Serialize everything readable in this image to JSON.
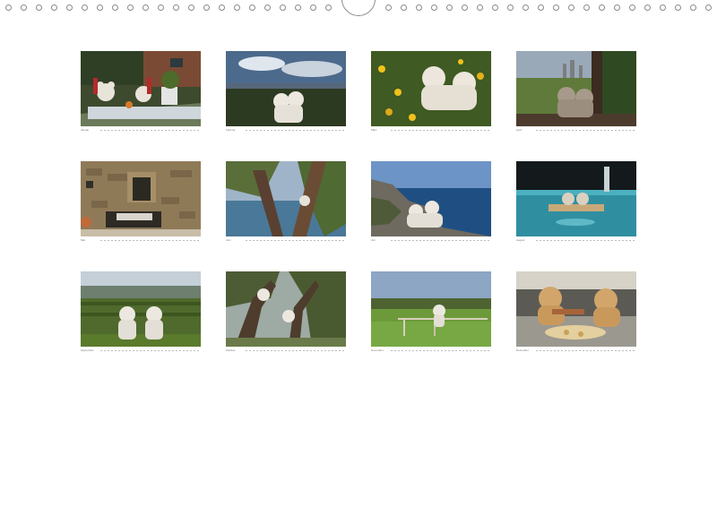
{
  "calendar": {
    "months": [
      {
        "name": "Januar"
      },
      {
        "name": "Februar"
      },
      {
        "name": "März"
      },
      {
        "name": "April"
      },
      {
        "name": "Mai"
      },
      {
        "name": "Juni"
      },
      {
        "name": "Juli"
      },
      {
        "name": "August"
      },
      {
        "name": "September"
      },
      {
        "name": "Oktober"
      },
      {
        "name": "November"
      },
      {
        "name": "Dezember"
      }
    ]
  }
}
